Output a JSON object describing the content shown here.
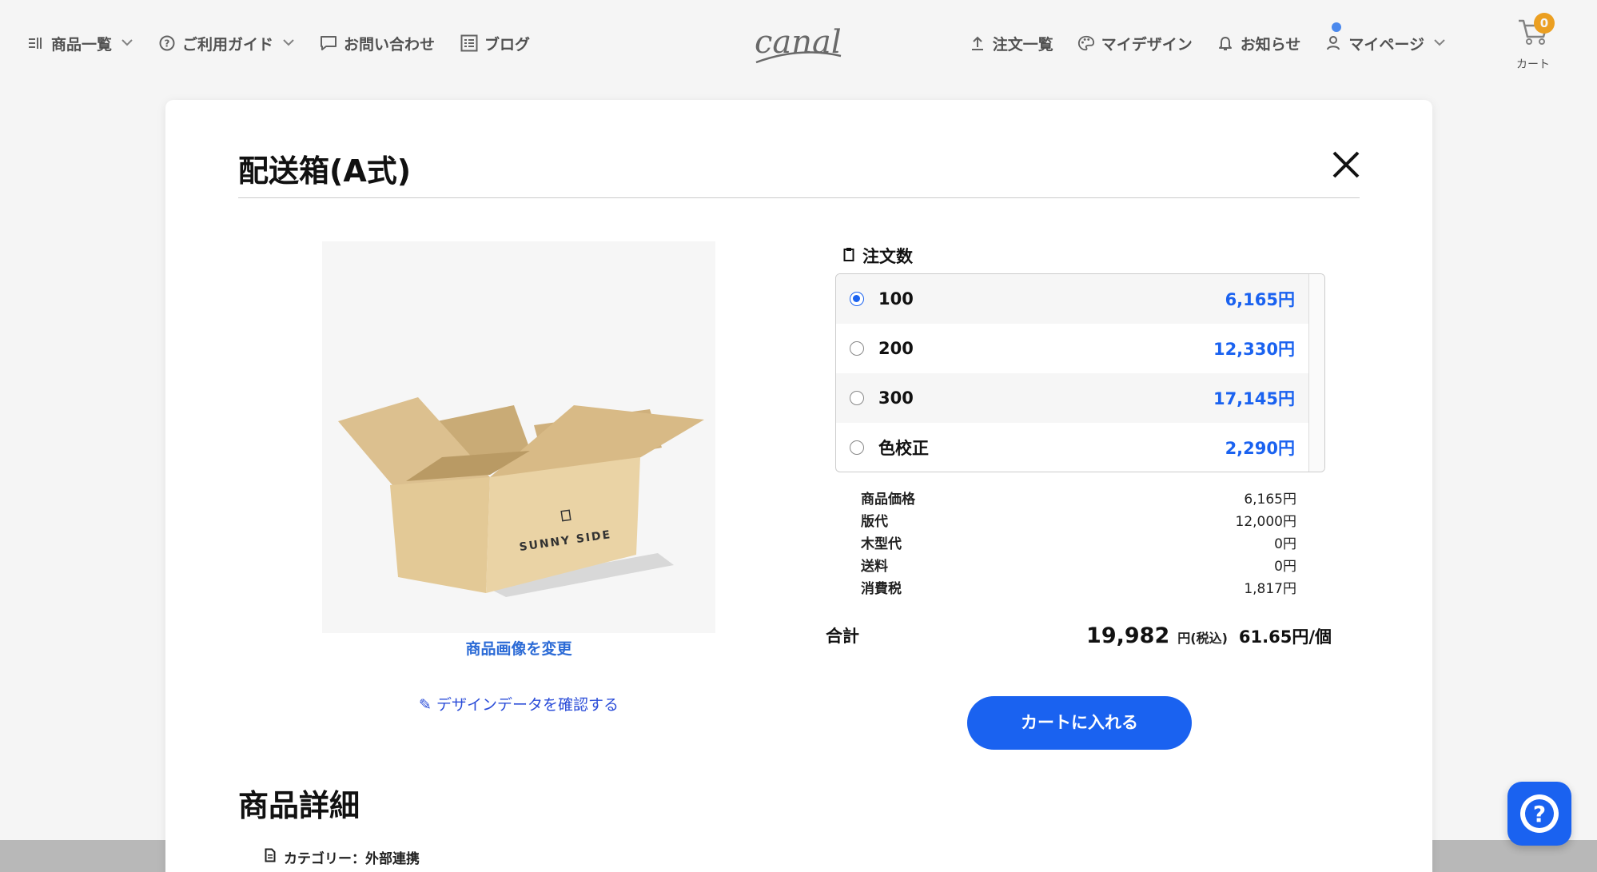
{
  "header": {
    "nav_left": [
      {
        "label": "商品一覧",
        "icon": "product-list-icon",
        "has_dropdown": true
      },
      {
        "label": "ご利用ガイド",
        "icon": "help-circle-icon",
        "has_dropdown": true
      },
      {
        "label": "お問い合わせ",
        "icon": "chat-icon",
        "has_dropdown": false
      },
      {
        "label": "ブログ",
        "icon": "blog-list-icon",
        "has_dropdown": false
      }
    ],
    "logo_text": "canal",
    "nav_right": [
      {
        "label": "注文一覧",
        "icon": "upload-icon",
        "has_dropdown": false
      },
      {
        "label": "マイデザイン",
        "icon": "palette-icon",
        "has_dropdown": false
      },
      {
        "label": "お知らせ",
        "icon": "bell-icon",
        "has_dropdown": false
      },
      {
        "label": "マイページ",
        "icon": "user-icon",
        "has_dropdown": true
      }
    ],
    "cart": {
      "label": "カート",
      "count": "0"
    }
  },
  "modal": {
    "title": "配送箱(A式)",
    "product_image": {
      "box_brand_text": "SUNNY SIDE"
    },
    "change_image_label": "商品画像を変更",
    "design_link_label": "デザインデータを確認する",
    "quantity": {
      "label": "注文数",
      "options": [
        {
          "value": "100",
          "price": "6,165円",
          "selected": true
        },
        {
          "value": "200",
          "price": "12,330円",
          "selected": false
        },
        {
          "value": "300",
          "price": "17,145円",
          "selected": false
        },
        {
          "value": "色校正",
          "price": "2,290円",
          "selected": false
        }
      ]
    },
    "breakdown": [
      {
        "label": "商品価格",
        "value": "6,165円"
      },
      {
        "label": "版代",
        "value": "12,000円"
      },
      {
        "label": "木型代",
        "value": "0円"
      },
      {
        "label": "送料",
        "value": "0円"
      },
      {
        "label": "消費税",
        "value": "1,817円"
      }
    ],
    "total": {
      "label": "合計",
      "amount": "19,982",
      "unit": "円(税込)",
      "per_unit": "61.65円/個"
    },
    "add_to_cart_label": "カートに入れる",
    "detail_title": "商品詳細",
    "category": "カテゴリー：外部連携"
  },
  "colors": {
    "accent": "#1a62f0",
    "price": "#1a62f0",
    "link": "#2c6bd6",
    "cart_badge": "#f5a623"
  }
}
